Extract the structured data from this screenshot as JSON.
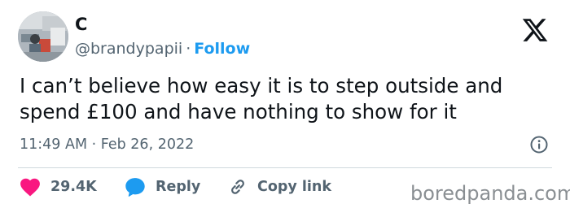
{
  "user": {
    "display_name": "C",
    "handle": "@brandypapii",
    "separator": "·",
    "follow_label": "Follow"
  },
  "tweet": {
    "text": "I can’t believe how easy it is to step outside and\nspend £100 and have nothing to show for it",
    "timestamp": "11:49 AM · Feb 26, 2022"
  },
  "actions": {
    "like_count": "29.4K",
    "reply_label": "Reply",
    "copy_link_label": "Copy link"
  },
  "icons": {
    "brand": "x-logo-icon",
    "info": "info-icon",
    "like": "heart-icon",
    "reply": "speech-bubble-icon",
    "copy": "link-icon"
  },
  "colors": {
    "accent": "#1d9bf0",
    "like": "#f91880",
    "text": "#0f1419",
    "secondary": "#536471"
  },
  "watermark": "boredpanda.com"
}
